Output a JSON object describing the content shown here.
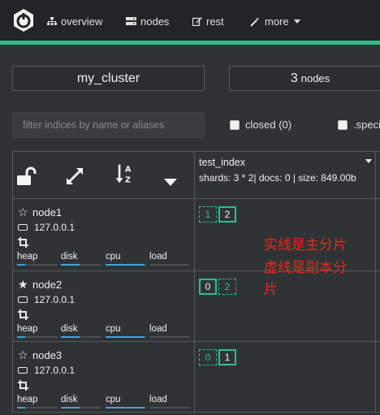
{
  "nav": {
    "items": [
      {
        "label": "overview",
        "icon": "sitemap-icon"
      },
      {
        "label": "nodes",
        "icon": "server-icon"
      },
      {
        "label": "rest",
        "icon": "edit-icon"
      },
      {
        "label": "more",
        "icon": "magic-wand-icon"
      }
    ],
    "accent_color": "#2bbf8a"
  },
  "cluster": {
    "name": "my_cluster",
    "node_count": "3",
    "node_label": "nodes"
  },
  "filter": {
    "placeholder": "filter indices by name or aliases",
    "closed_label": "closed (0)",
    "special_label": ".speci"
  },
  "index": {
    "name": "test_index",
    "meta": "shards: 3 * 2| docs: 0 | size: 849.00b"
  },
  "metric_labels": {
    "heap": "heap",
    "disk": "disk",
    "cpu": "cpu",
    "load": "load"
  },
  "nodes": [
    {
      "name": "node1",
      "master": false,
      "ip": "127.0.0.1",
      "shards": [
        {
          "label": "1",
          "type": "replica"
        },
        {
          "label": "2",
          "type": "primary"
        }
      ],
      "metrics": {
        "heap": 0.2,
        "disk": 0.45,
        "cpu": 0.95,
        "load": 0.0
      }
    },
    {
      "name": "node2",
      "master": true,
      "ip": "127.0.0.1",
      "shards": [
        {
          "label": "0",
          "type": "primary"
        },
        {
          "label": "2",
          "type": "replica"
        }
      ],
      "metrics": {
        "heap": 0.2,
        "disk": 0.45,
        "cpu": 0.95,
        "load": 0.0
      }
    },
    {
      "name": "node3",
      "master": false,
      "ip": "127.0.0.1",
      "shards": [
        {
          "label": "0",
          "type": "replica"
        },
        {
          "label": "1",
          "type": "primary"
        }
      ],
      "metrics": {
        "heap": 0.2,
        "disk": 0.45,
        "cpu": 0.95,
        "load": 0.0
      }
    }
  ],
  "annotation": {
    "line1": "实线是主分片",
    "line2": "虚线是副本分",
    "line3": "片",
    "color": "#e8281f"
  }
}
